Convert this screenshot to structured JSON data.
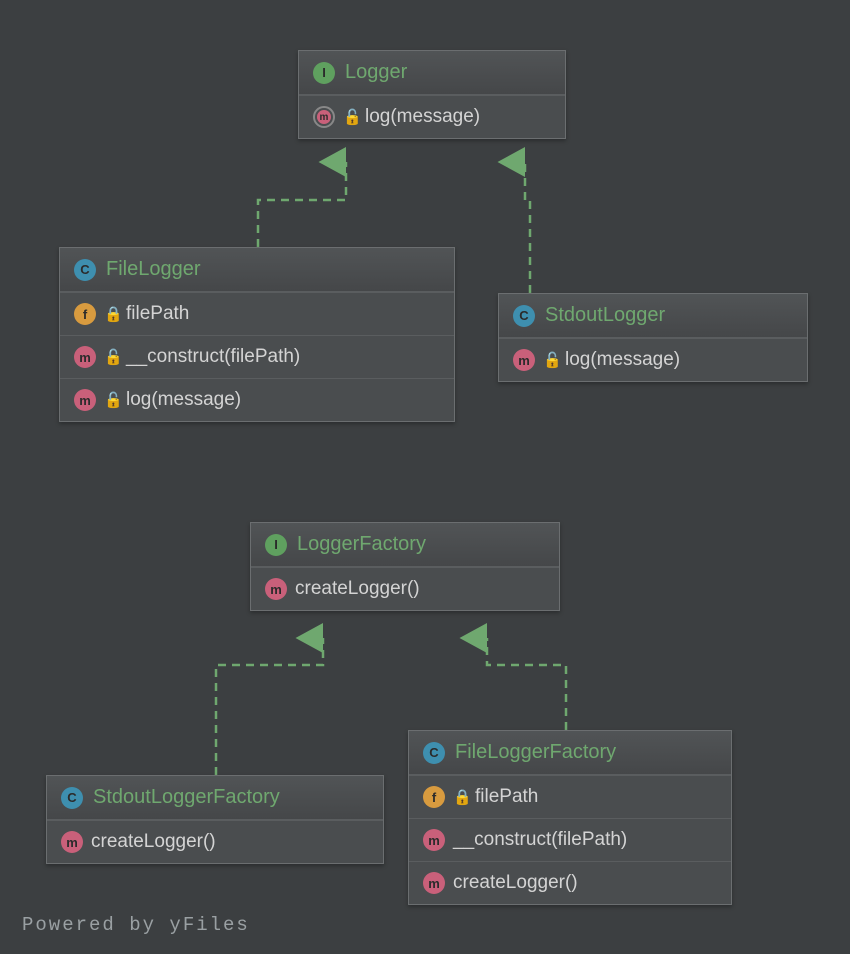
{
  "classes": {
    "logger": {
      "name": "Logger",
      "type": "I",
      "members": [
        {
          "kind": "m",
          "abstract": true,
          "mod": "unlock",
          "sig": "log(message)"
        }
      ]
    },
    "fileLogger": {
      "name": "FileLogger",
      "type": "C",
      "members": [
        {
          "kind": "f",
          "mod": "lock",
          "sig": "filePath"
        },
        {
          "kind": "m",
          "mod": "unlock",
          "sig": "__construct(filePath)"
        },
        {
          "kind": "m",
          "mod": "unlock",
          "sig": "log(message)"
        }
      ]
    },
    "stdoutLogger": {
      "name": "StdoutLogger",
      "type": "C",
      "members": [
        {
          "kind": "m",
          "mod": "unlock",
          "sig": "log(message)"
        }
      ]
    },
    "loggerFactory": {
      "name": "LoggerFactory",
      "type": "I",
      "members": [
        {
          "kind": "m",
          "sig": "createLogger()"
        }
      ]
    },
    "stdoutLoggerFactory": {
      "name": "StdoutLoggerFactory",
      "type": "C",
      "members": [
        {
          "kind": "m",
          "sig": "createLogger()"
        }
      ]
    },
    "fileLoggerFactory": {
      "name": "FileLoggerFactory",
      "type": "C",
      "members": [
        {
          "kind": "f",
          "mod": "lock",
          "sig": "filePath"
        },
        {
          "kind": "m",
          "sig": "__construct(filePath)"
        },
        {
          "kind": "m",
          "sig": "createLogger()"
        }
      ]
    }
  },
  "footer": "Powered by yFiles"
}
